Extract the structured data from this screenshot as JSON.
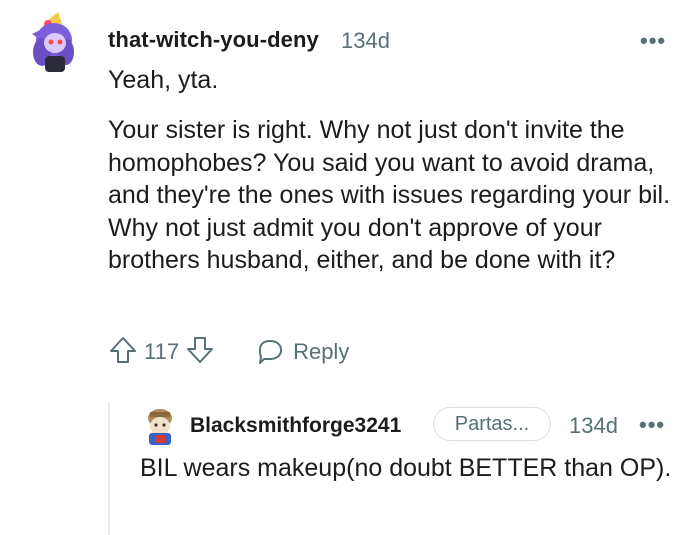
{
  "comment": {
    "username": "that-witch-you-deny",
    "age": "134d",
    "more": "•••",
    "paragraphs": [
      "Yeah, yta.",
      "Your sister is right. Why not just don't invite the homophobes? You said you want to avoid drama, and they're the ones with issues regarding your bil. Why not just admit you don't approve of your brothers husband, either, and be done with it?"
    ],
    "votes": "117",
    "reply_label": "Reply"
  },
  "reply": {
    "username": "Blacksmithforge3241",
    "flair": "Partas...",
    "age": "134d",
    "more": "•••",
    "text": "BIL wears makeup(no doubt BETTER than OP)."
  },
  "colors": {
    "text": "#1c1c1c",
    "meta": "#576f76",
    "thread_line": "#e5ebee",
    "avatar_purple": "#7b5fd6"
  },
  "icons": [
    "avatar-witch",
    "more-icon",
    "upvote-icon",
    "downvote-icon",
    "reply-icon",
    "avatar-blacksmith"
  ]
}
